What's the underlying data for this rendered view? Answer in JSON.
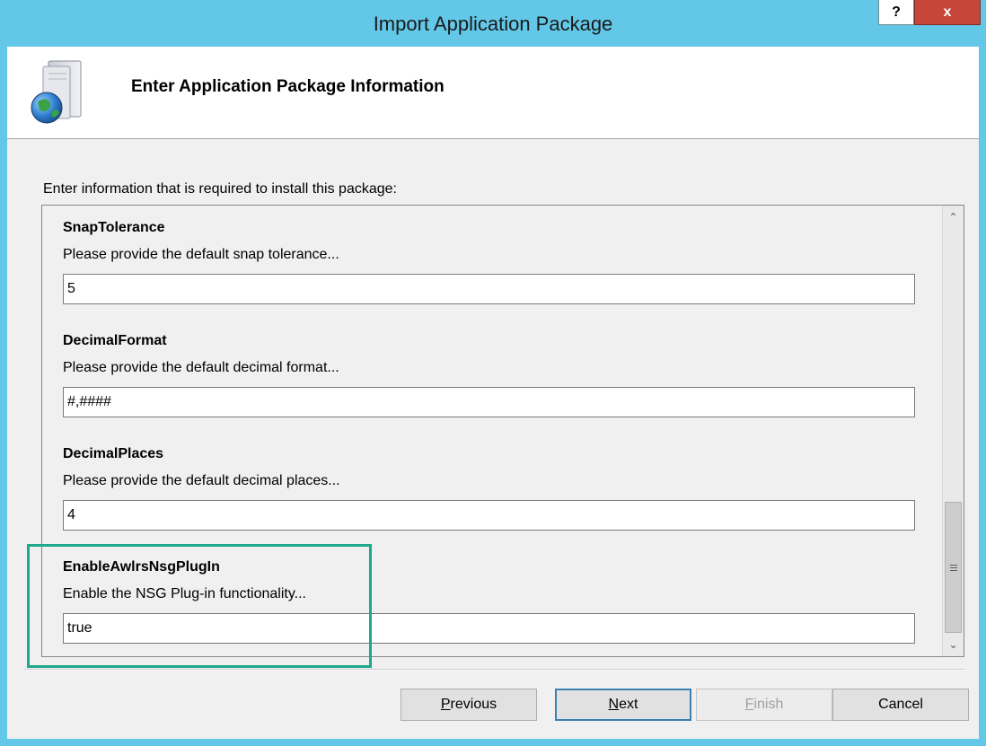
{
  "window": {
    "title": "Import Application Package",
    "help_label": "?",
    "close_label": "x"
  },
  "header": {
    "title": "Enter Application Package Information",
    "icon": "package-globe-icon"
  },
  "intro": "Enter information that is required to install this package:",
  "parameters": [
    {
      "name": "SnapTolerance",
      "description": "Please provide the default snap tolerance...",
      "value": "5"
    },
    {
      "name": "DecimalFormat",
      "description": "Please provide the default decimal format...",
      "value": "#,####"
    },
    {
      "name": "DecimalPlaces",
      "description": "Please provide the default decimal places...",
      "value": "4"
    },
    {
      "name": "EnableAwlrsNsgPlugIn",
      "description": "Enable the NSG Plug-in functionality...",
      "value": "true"
    }
  ],
  "buttons": {
    "previous": {
      "mnemonic": "P",
      "rest": "revious"
    },
    "next": {
      "mnemonic": "N",
      "rest": "ext"
    },
    "finish": {
      "mnemonic": "F",
      "rest": "inish"
    },
    "cancel": "Cancel"
  },
  "colors": {
    "titlebar": "#63c8e8",
    "highlight": "#1fa88a",
    "close": "#c7463b"
  }
}
